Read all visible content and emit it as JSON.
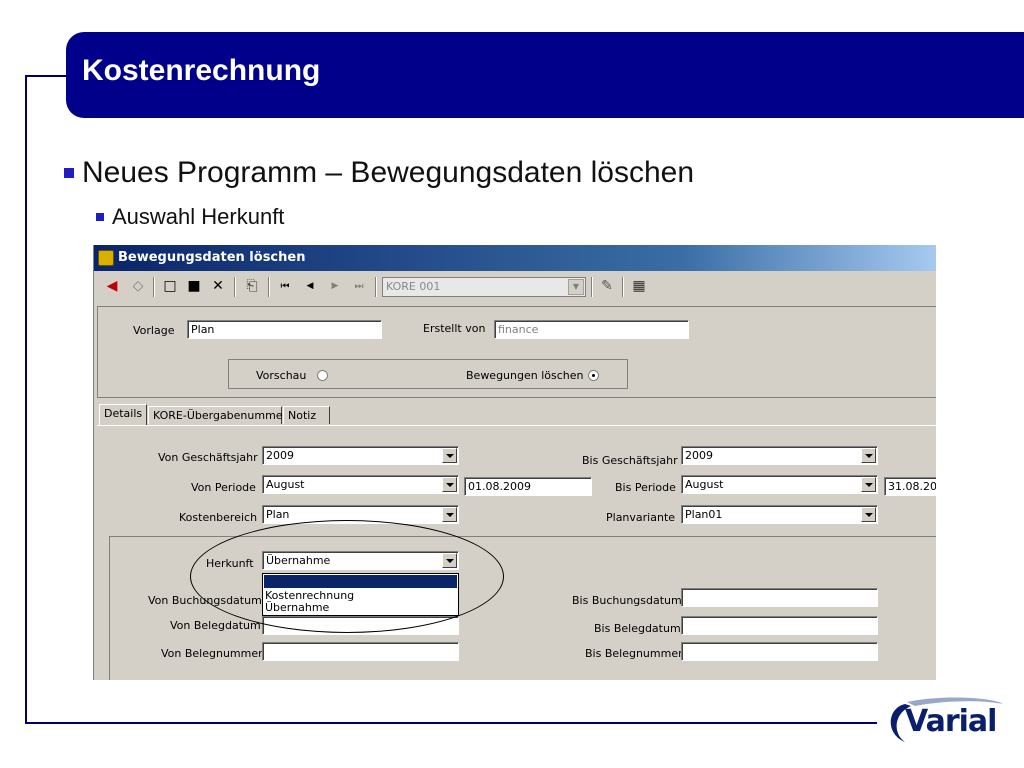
{
  "slide": {
    "title": "Kostenrechnung",
    "bullet1": "Neues Programm – Bewegungsdaten löschen",
    "bullet2": "Auswahl Herkunft",
    "logo": "Varial"
  },
  "window": {
    "title": "Bewegungsdaten löschen",
    "toolbar": {
      "combo_value": "KORE 001",
      "icons": [
        "back-arrow-icon",
        "eraser-icon",
        "new-document-icon",
        "stop-icon",
        "delete-icon",
        "print-icon",
        "first-record-icon",
        "previous-record-icon",
        "next-record-icon",
        "last-record-icon",
        "export-icon",
        "settings-icon"
      ]
    },
    "header": {
      "vorlage_label": "Vorlage",
      "vorlage_value": "Plan",
      "erstellt_von_label": "Erstellt von",
      "erstellt_von_value": "finance",
      "vorschau_label": "Vorschau",
      "bewegungen_loeschen_label": "Bewegungen löschen",
      "selected_mode": "Bewegungen löschen"
    },
    "tabs": [
      {
        "label": "Details",
        "active": true
      },
      {
        "label": "KORE-Übergabenummer",
        "active": false
      },
      {
        "label": "Notiz",
        "active": false
      }
    ],
    "details": {
      "von_geschaeftsjahr_label": "Von Geschäftsjahr",
      "von_geschaeftsjahr_value": "2009",
      "bis_geschaeftsjahr_label": "Bis Geschäftsjahr",
      "bis_geschaeftsjahr_value": "2009",
      "von_periode_label": "Von Periode",
      "von_periode_value": "August",
      "von_periode_date": "01.08.2009",
      "bis_periode_label": "Bis Periode",
      "bis_periode_value": "August",
      "bis_periode_date": "31.08.20",
      "kostenbereich_label": "Kostenbereich",
      "kostenbereich_value": "Plan",
      "planvariante_label": "Planvariante",
      "planvariante_value": "Plan01",
      "herkunft_label": "Herkunft",
      "herkunft_value": "Übernahme",
      "herkunft_options": [
        "",
        "Kostenrechnung",
        "Übernahme"
      ],
      "von_buchungsdatum_label": "Von Buchungsdatum",
      "bis_buchungsdatum_label": "Bis Buchungsdatum",
      "von_belegdatum_label": "Von Belegdatum",
      "bis_belegdatum_label": "Bis Belegdatum",
      "von_belegnummer_label": "Von Belegnummer",
      "bis_belegnummer_label": "Bis Belegnummer"
    }
  },
  "colors": {
    "title_bar": "#00008b",
    "bullet": "#1f1fbf",
    "window_title": "#0a246a",
    "dialog_bg": "#d4d0c8"
  }
}
